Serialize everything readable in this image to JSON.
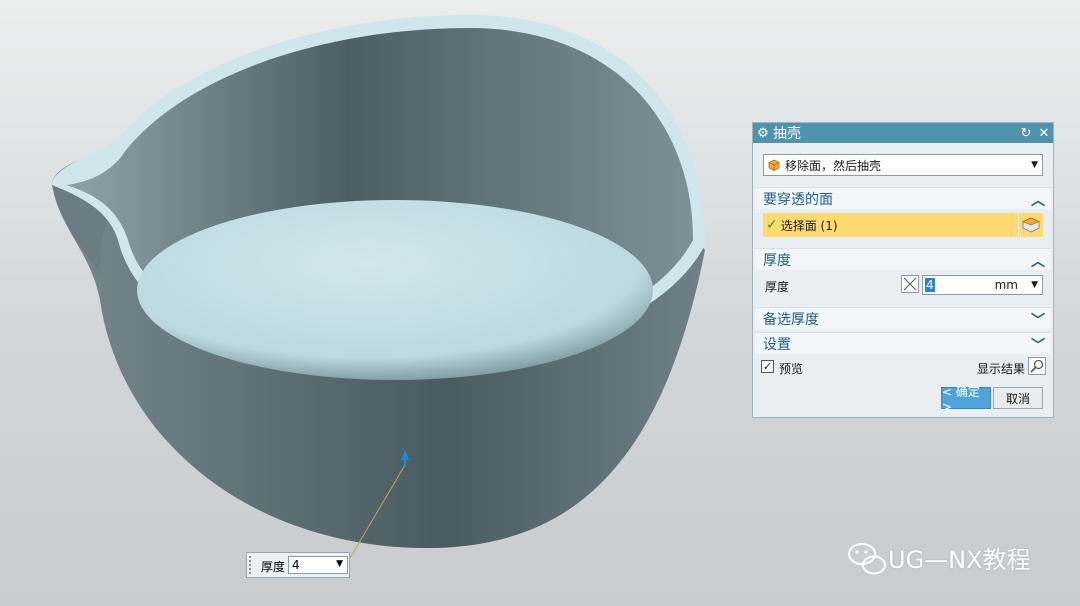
{
  "dialog": {
    "title": "抽壳",
    "type_value": "移除面，然后抽壳",
    "section_faces": {
      "header": "要穿透的面",
      "select_label": "选择面 (1)"
    },
    "section_thickness": {
      "header": "厚度",
      "label": "厚度",
      "value": "4",
      "unit": "mm"
    },
    "section_alt_thickness": {
      "header": "备选厚度"
    },
    "section_settings": {
      "header": "设置"
    },
    "preview_label": "预览",
    "preview_checked": true,
    "show_result_label": "显示结果",
    "ok_label": "< 确定 >",
    "cancel_label": "取消"
  },
  "canvas_input": {
    "label": "厚度",
    "value": "4"
  },
  "watermark": {
    "text": "UG—NX教程"
  },
  "colors": {
    "titlebar": "#4f93ad",
    "section_header_text": "#1f5f86",
    "selection_highlight": "#ffd972",
    "model_body": "#5c6f74",
    "model_inner_floor": "#c7e0e6"
  },
  "icons": [
    "gear-icon",
    "reset-icon",
    "close-icon",
    "shell-type-icon",
    "checkmark-icon",
    "face-select-icon",
    "thickness-icon",
    "magnifier-icon",
    "chevron-up-icon",
    "chevron-down-icon",
    "direction-arrow-icon",
    "wechat-icon"
  ]
}
